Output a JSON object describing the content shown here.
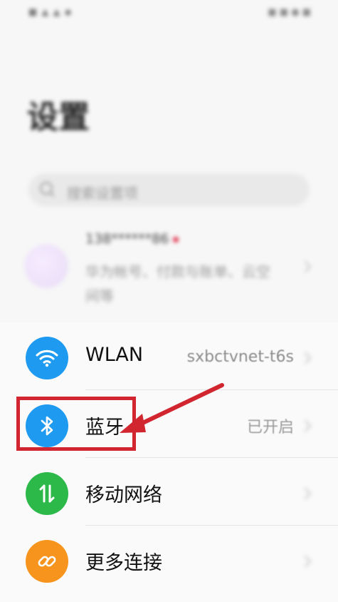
{
  "status_bar": {
    "left": "■ ▲ ▲ ◆",
    "right": "■ ■ ● ■"
  },
  "header": {
    "title": "设置"
  },
  "search": {
    "placeholder": "搜索设置项"
  },
  "account": {
    "name": "138******86",
    "description": "华为帐号、付款与账单、云空间等"
  },
  "settings": [
    {
      "label": "WLAN",
      "value": "sxbctvnet-t6s",
      "icon": "wifi-icon",
      "color": "#1e9bf0"
    },
    {
      "label": "蓝牙",
      "value": "已开启",
      "icon": "bluetooth-icon",
      "color": "#1e9bf0"
    },
    {
      "label": "移动网络",
      "value": "",
      "icon": "mobile-network-icon",
      "color": "#2db84a"
    },
    {
      "label": "更多连接",
      "value": "",
      "icon": "link-icon",
      "color": "#f7941d"
    }
  ],
  "annotation": {
    "highlight_color": "#d1262f"
  }
}
